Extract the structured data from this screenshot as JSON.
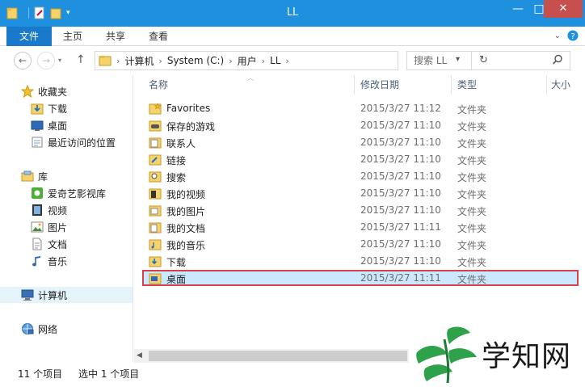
{
  "window": {
    "title": "LL",
    "min_glyph": "—",
    "max_glyph": "□",
    "close_glyph": "✕"
  },
  "ribbon": {
    "tabs": [
      "文件",
      "主页",
      "共享",
      "查看"
    ]
  },
  "address": {
    "crumbs": [
      "计算机",
      "System (C:)",
      "用户",
      "LL"
    ],
    "search_placeholder": "搜索 LL"
  },
  "navpane": {
    "favorites": {
      "label": "收藏夹",
      "items": [
        "下载",
        "桌面",
        "最近访问的位置"
      ]
    },
    "libraries": {
      "label": "库",
      "items": [
        "爱奇艺影视库",
        "视频",
        "图片",
        "文档",
        "音乐"
      ]
    },
    "computer": "计算机",
    "network": "网络"
  },
  "columns": {
    "name": "名称",
    "date": "修改日期",
    "type": "类型",
    "size": "大小"
  },
  "files": [
    {
      "name": "Favorites",
      "date": "2015/3/27 11:12",
      "type": "文件夹",
      "icon": "star-folder-icon"
    },
    {
      "name": "保存的游戏",
      "date": "2015/3/27 11:10",
      "type": "文件夹",
      "icon": "games-folder-icon"
    },
    {
      "name": "联系人",
      "date": "2015/3/27 11:10",
      "type": "文件夹",
      "icon": "contacts-folder-icon"
    },
    {
      "name": "链接",
      "date": "2015/3/27 11:10",
      "type": "文件夹",
      "icon": "links-folder-icon"
    },
    {
      "name": "搜索",
      "date": "2015/3/27 11:10",
      "type": "文件夹",
      "icon": "search-folder-icon"
    },
    {
      "name": "我的视频",
      "date": "2015/3/27 11:10",
      "type": "文件夹",
      "icon": "video-folder-icon"
    },
    {
      "name": "我的图片",
      "date": "2015/3/27 11:10",
      "type": "文件夹",
      "icon": "picture-folder-icon"
    },
    {
      "name": "我的文档",
      "date": "2015/3/27 11:11",
      "type": "文件夹",
      "icon": "document-folder-icon"
    },
    {
      "name": "我的音乐",
      "date": "2015/3/27 11:10",
      "type": "文件夹",
      "icon": "music-folder-icon"
    },
    {
      "name": "下载",
      "date": "2015/3/27 11:10",
      "type": "文件夹",
      "icon": "download-folder-icon"
    },
    {
      "name": "桌面",
      "date": "2015/3/27 11:11",
      "type": "文件夹",
      "icon": "desktop-folder-icon",
      "selected": true
    }
  ],
  "status": {
    "count": "11 个项目",
    "selection": "选中 1 个项目"
  },
  "watermark": {
    "text": "学知网"
  },
  "colors": {
    "titlebar": "#1e90dd",
    "file_tab": "#1979ca",
    "close": "#c7504f",
    "selection": "#cce8ff",
    "highlight_border": "#d6414a",
    "folder": "#f0c65a",
    "watermark_green": "#2ea24a"
  }
}
